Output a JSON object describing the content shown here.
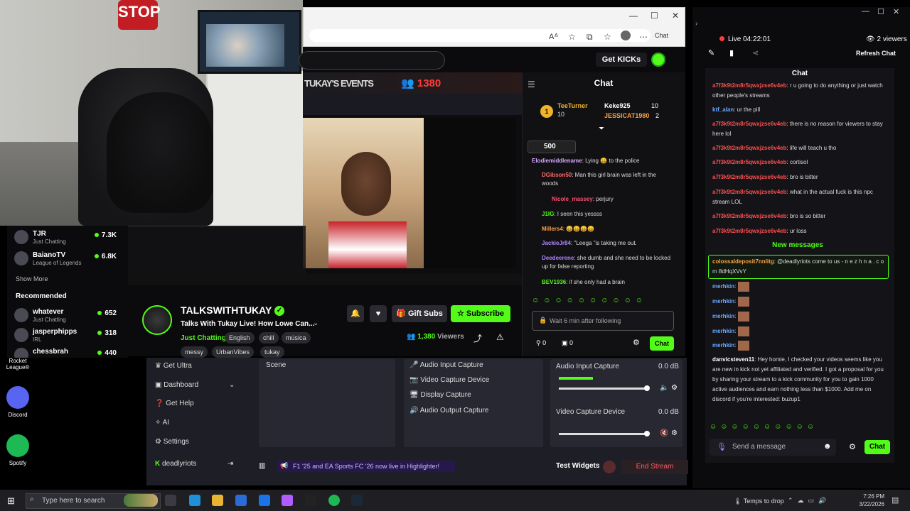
{
  "webcam": {
    "sign_text": "STOP"
  },
  "browser": {
    "chat_label": "Chat"
  },
  "kick": {
    "get_kicks": "Get KICKs",
    "stream_banner": {
      "title": "TUKAY'S EVENTS",
      "count": "1380"
    },
    "sidebar": {
      "items": [
        {
          "name": "TJR",
          "category": "Just Chatting",
          "viewers": "7.3K"
        },
        {
          "name": "BaianoTV",
          "category": "League of Legends",
          "viewers": "6.8K"
        }
      ],
      "show_more": "Show More",
      "recommended": "Recommended",
      "recommended_items": [
        {
          "name": "whatever",
          "category": "Just Chatting",
          "viewers": "652"
        },
        {
          "name": "jasperphipps",
          "category": "IRL",
          "viewers": "318"
        },
        {
          "name": "chessbrah",
          "category": "",
          "viewers": "440"
        }
      ]
    },
    "channel": {
      "name": "TALKSWITHTUKAY",
      "title": "Talks With Tukay Live!  How Lowe Can...",
      "category": "Just Chatting",
      "tags": [
        "English",
        "chill",
        "música",
        "messy",
        "UrbanVibes",
        "tukay"
      ],
      "viewers_count": "1,380",
      "viewers_label": "Viewers"
    },
    "buttons": {
      "gift": "Gift Subs",
      "subscribe": "Subscribe"
    },
    "chat": {
      "header": "Chat",
      "leader": {
        "rank": "1",
        "name": "TeeTurner",
        "pts": "10",
        "n2": "Keke925",
        "p2": "10",
        "n3": "JESSICAT1980",
        "p3": "2"
      },
      "pinned_amount": "500",
      "messages": [
        {
          "user": "Elodiemiddlename",
          "text": ": Lying 😄 to the police",
          "color": "#d7a8ff"
        },
        {
          "user": "DGibson50",
          "text": ": Man this girl brain was left in the woods",
          "color": "#ff6b6b"
        },
        {
          "user": "Nicole_massey",
          "text": ": perjury",
          "color": "#ff4d6d"
        },
        {
          "user": "J1IG",
          "text": ": I seen this yessss",
          "color": "#53fc18"
        },
        {
          "user": "Millers4",
          "text": ": 😄😄😄😄",
          "color": "#ff9f43"
        },
        {
          "user": "JackieJr84",
          "text": ": \"Leega \"is taking me out.",
          "color": "#b084ff"
        },
        {
          "user": "Deedeerene",
          "text": ": she dumb and she need to be locked up for false reporting",
          "color": "#b084ff"
        },
        {
          "user": "BEV1936",
          "text": ": if she only had a brain",
          "color": "#53fc18"
        }
      ],
      "input_placeholder": "Wait 6 min after following",
      "count_a": "0",
      "count_b": "0",
      "send": "Chat"
    }
  },
  "obs": {
    "nav": [
      "Get Ultra",
      "Dashboard",
      "Get Help",
      "AI",
      "Settings",
      "deadlyriots"
    ],
    "scene_label": "Scene",
    "sources": [
      "Audio Input Capture",
      "Video Capture Device",
      "Display Capture",
      "Audio Output Capture"
    ],
    "mixer": [
      {
        "name": "Audio Input Capture",
        "db": "0.0 dB"
      },
      {
        "name": "Video Capture Device",
        "db": "0.0 dB"
      }
    ],
    "banner": "F1 '25 and EA Sports FC '26 now live in Highlighter!",
    "test_widgets": "Test Widgets",
    "end_stream": "End Stream"
  },
  "rightchat": {
    "live_time": "Live 04:22:01",
    "viewers": "2 viewers",
    "refresh": "Refresh Chat",
    "header": "Chat",
    "messages": [
      {
        "user": "a7f3k9t2m8r5qwxjzse6v4eb",
        "text": ": r u going to do anything or just watch other people's streams",
        "color": "#ff4d4d"
      },
      {
        "user": "ktf_alan",
        "text": ": ur the pill",
        "color": "#6aa9ff"
      },
      {
        "user": "a7f3k9t2m8r5qwxjzse6v4eb",
        "text": ": there is no reason for viewers to stay here lol",
        "color": "#ff4d4d"
      },
      {
        "user": "a7f3k9t2m8r5qwxjzse6v4eb",
        "text": ": life will teach u tho",
        "color": "#ff4d4d"
      },
      {
        "user": "a7f3k9t2m8r5qwxjzse6v4eb",
        "text": ": cortisol",
        "color": "#ff4d4d"
      },
      {
        "user": "a7f3k9t2m8r5qwxjzse6v4eb",
        "text": ": bro is bitter",
        "color": "#ff4d4d"
      },
      {
        "user": "a7f3k9t2m8r5qwxjzse6v4eb",
        "text": ": what in the actual fuck is this npc stream LOL",
        "color": "#ff4d4d"
      },
      {
        "user": "a7f3k9t2m8r5qwxjzse6v4eb",
        "text": ": bro is so bitter",
        "color": "#ff4d4d"
      },
      {
        "user": "a7f3k9t2m8r5qwxjzse6v4eb",
        "text": ": ur loss",
        "color": "#ff4d4d"
      }
    ],
    "new_messages": "New messages",
    "highlight": {
      "user": "colossaldeposit7nnlitg",
      "text": ": @deadlyriots come to us - n e z h n a . c o m 8dHqXVvY"
    },
    "merhkin": "merhkin",
    "long_msg": {
      "user": "danvicsteven11",
      "text": ": Hey homie, I checked your videos seems like you are new in kick not yet affiliated and verified. I got a proposal for you by sharing your stream to a kick community for you to gain 1000 active audiences and earn nothing less than $1000. Add me on discord if you're interested: buzup1"
    },
    "input_placeholder": "Send a message",
    "send": "Chat"
  },
  "desktop": {
    "icons": [
      "Rocket League®",
      "Discord",
      "Spotify"
    ]
  },
  "taskbar": {
    "search": "Type here to search",
    "temps": "Temps to drop",
    "time": "7:26 PM",
    "date": "3/22/2026"
  }
}
